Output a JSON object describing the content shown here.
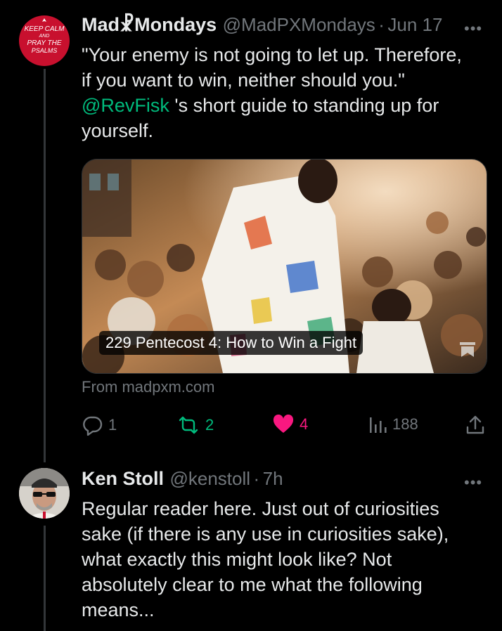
{
  "tweet1": {
    "avatar_text": [
      "KEEP CALM",
      "AND",
      "PRAY THE",
      "PSALMS"
    ],
    "display_name": "Mad☧Mondays",
    "handle": "@MadPXMondays",
    "separator": "·",
    "date": "Jun 17",
    "more_label": "•••",
    "text_line1": "\"Your enemy is not going to let up. Therefore,",
    "text_line2": "if you want to win, neither should you.\"",
    "mention": "@RevFisk",
    "text_after_mention": " 's short guide to standing up for",
    "text_line4": "yourself.",
    "card": {
      "title": "229 Pentecost 4: How to Win a Fight",
      "source": "From madpxm.com"
    },
    "actions": {
      "replies": "1",
      "reposts": "2",
      "likes": "4",
      "views": "188"
    }
  },
  "tweet2": {
    "display_name": "Ken Stoll",
    "handle": "@kenstoll",
    "separator": "·",
    "time": "7h",
    "more_label": "•••",
    "lines": [
      "Regular reader here. Just out of curiosities",
      "sake (if there is any use in curiosities sake),",
      "what exactly this might look like? Not",
      "absolutely clear to me what the following",
      "means..."
    ]
  },
  "colors": {
    "background": "#000000",
    "text": "#e7e9ea",
    "muted": "#71767b",
    "mention": "#00ba7c",
    "repost": "#00ba7c",
    "like": "#f91880",
    "avatar_red": "#c8102e"
  },
  "icons": [
    "reply-icon",
    "repost-icon",
    "heart-icon",
    "views-icon",
    "share-icon",
    "bookmark-icon"
  ]
}
